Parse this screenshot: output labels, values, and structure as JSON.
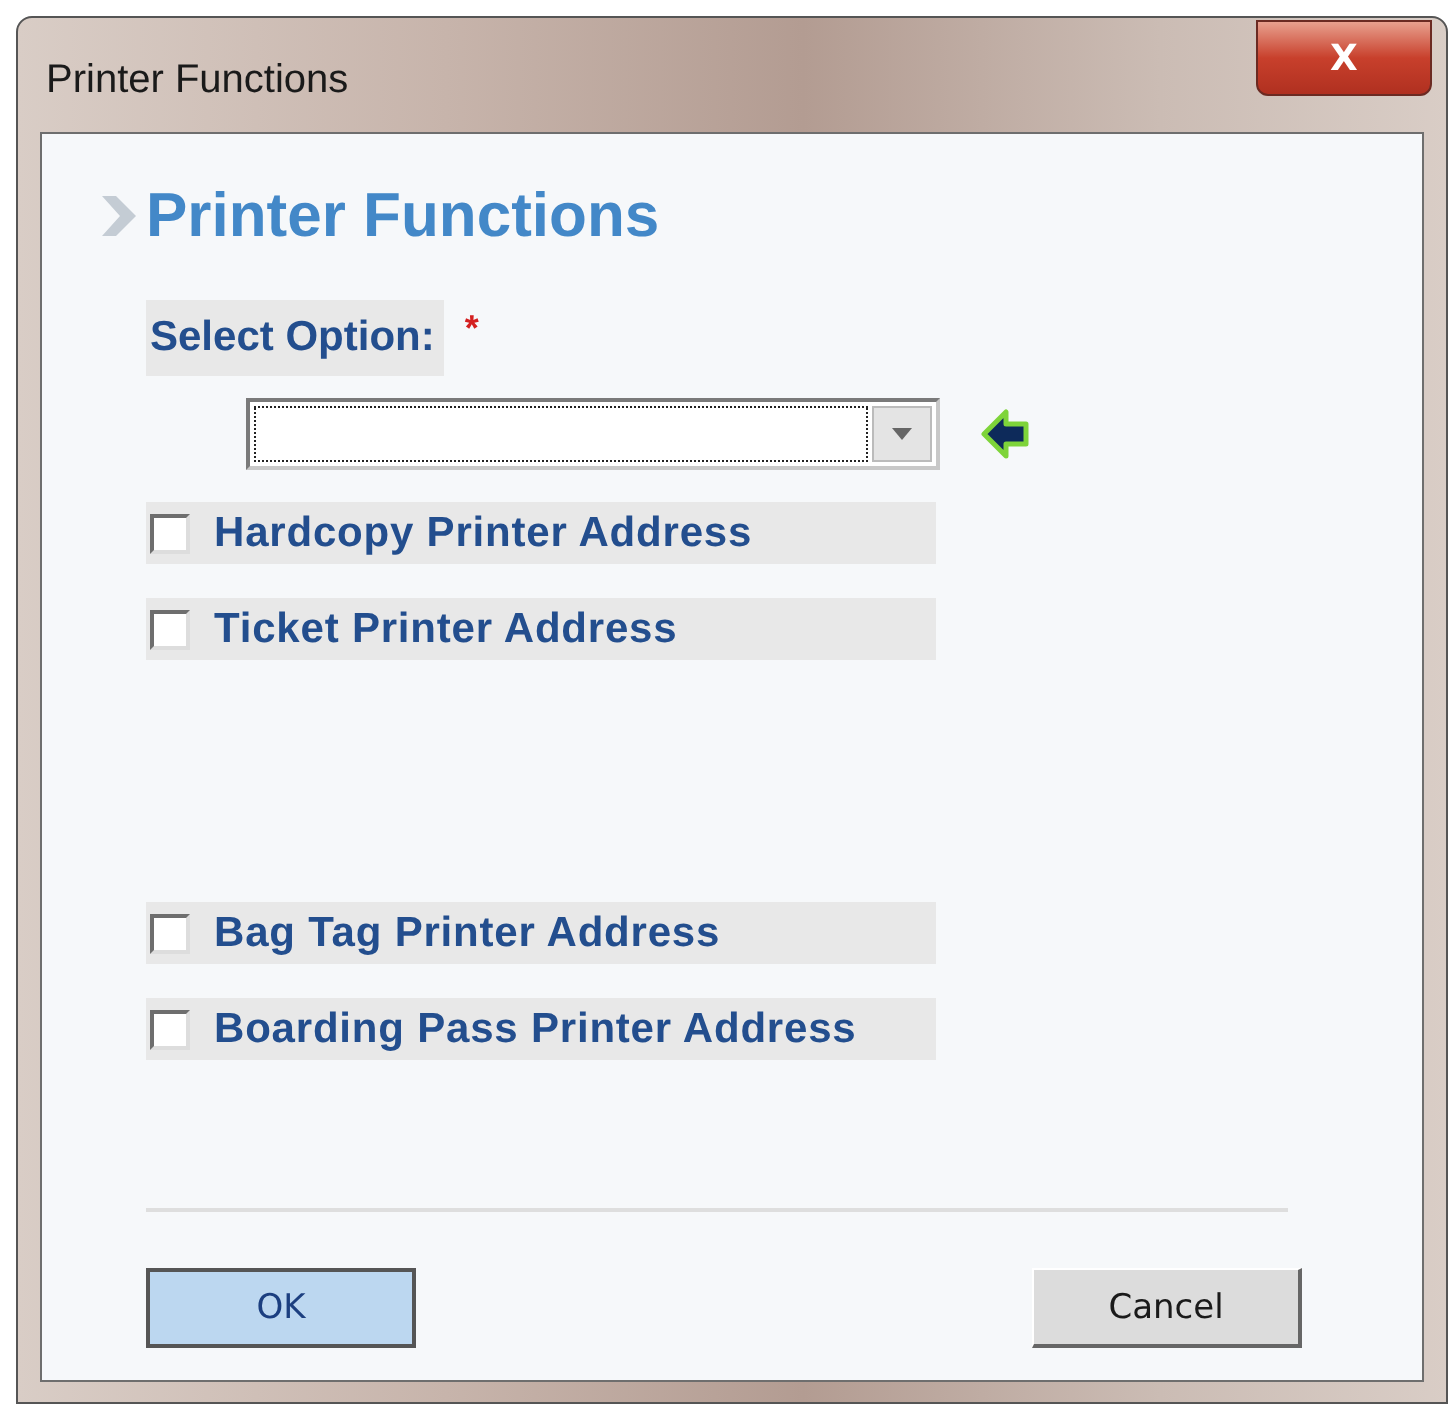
{
  "window": {
    "title": "Printer Functions",
    "close_label": "X"
  },
  "heading": "Printer Functions",
  "select": {
    "label": "Select Option:",
    "required_mark": "*"
  },
  "options": [
    {
      "label": "Hardcopy Printer Address",
      "checked": false
    },
    {
      "label": "Ticket Printer Address",
      "checked": false
    },
    {
      "label": "Bag Tag Printer Address",
      "checked": false
    },
    {
      "label": "Boarding Pass Printer Address",
      "checked": false
    }
  ],
  "buttons": [
    {
      "label": "OK",
      "kind": "default"
    },
    {
      "label": "Cancel",
      "kind": "normal"
    }
  ]
}
